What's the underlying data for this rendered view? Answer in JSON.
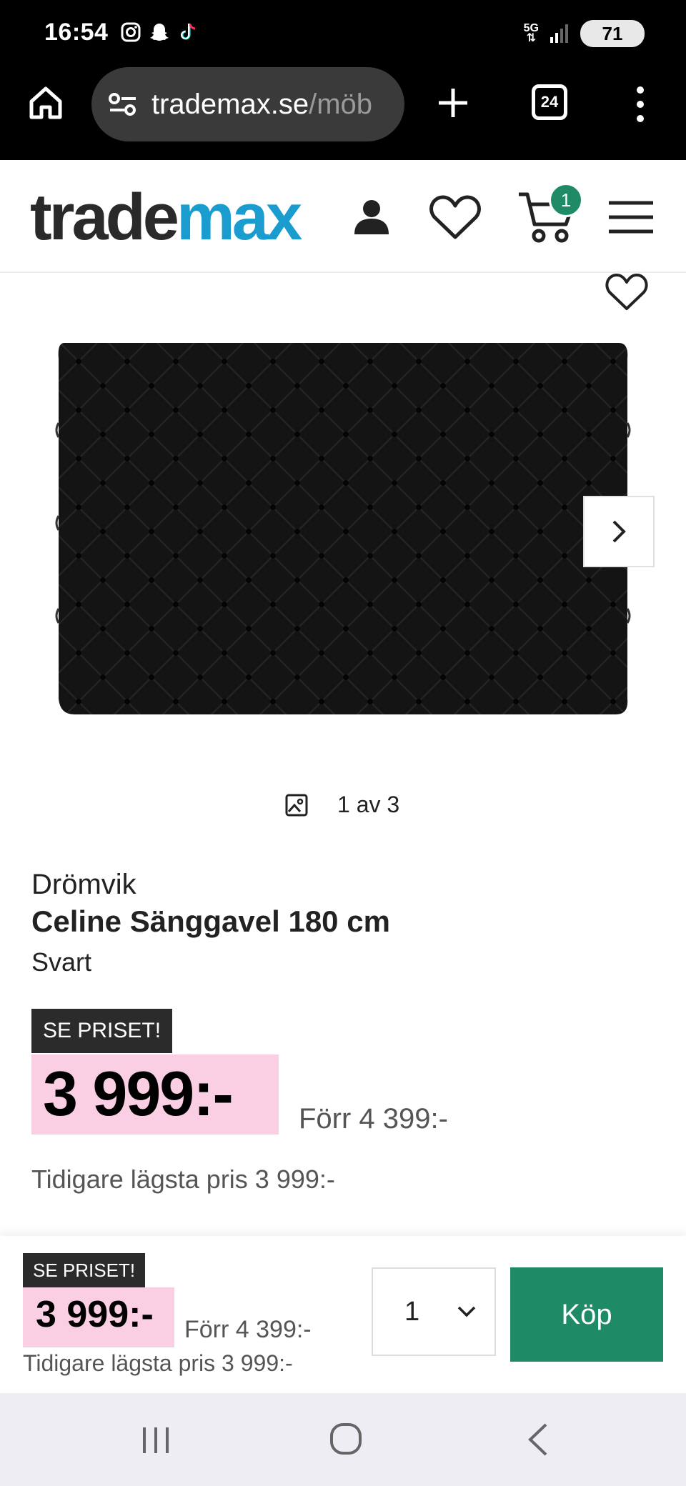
{
  "status_bar": {
    "time": "16:54",
    "network": "5G",
    "battery": "71"
  },
  "browser": {
    "url_main": "trademax.se",
    "url_rest": "/möb",
    "tab_count": "24"
  },
  "site": {
    "logo_part1": "trade",
    "logo_part2": "max",
    "cart_count": "1",
    "brand_color": "#1a9ccf",
    "accent_color": "#1e8b66"
  },
  "gallery": {
    "counter": "1 av 3"
  },
  "product": {
    "brand": "Drömvik",
    "title": "Celine Sänggavel 180 cm",
    "variant": "Svart",
    "badge": "SE PRISET!",
    "price": "3 999:-",
    "previous_price": "Förr 4 399:-",
    "lowest_price": "Tidigare lägsta pris 3 999:-",
    "price_highlight_color": "#fbcfe3"
  },
  "buy_bar": {
    "badge": "SE PRISET!",
    "price": "3 999:-",
    "previous_price": "Förr 4 399:-",
    "lowest_price": "Tidigare lägsta pris 3 999:-",
    "quantity": "1",
    "buy_label": "Köp"
  }
}
